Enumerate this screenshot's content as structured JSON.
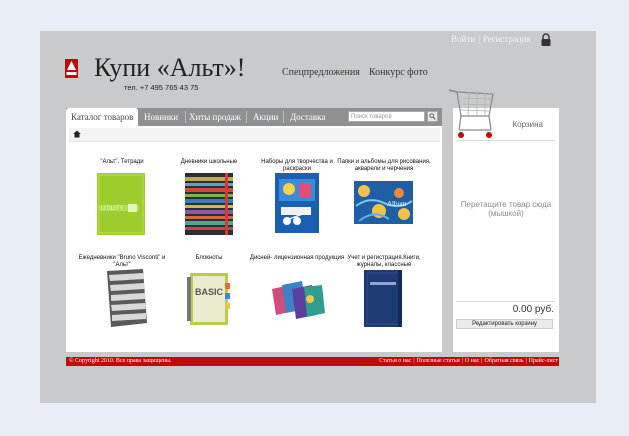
{
  "header": {
    "brand": "Купи «Альт»!",
    "phone": "тел.   +7 495 765 43 75",
    "links": [
      "Спецпредложения",
      "Конкурс фото"
    ],
    "login": "Войти",
    "separator": "|",
    "register": "Регистрация"
  },
  "nav": {
    "tabs": [
      "Каталог товаров",
      "Новинки",
      "Хиты продаж",
      "Акции",
      "Доставка"
    ],
    "search_placeholder": "Поиск товаров"
  },
  "catalog": {
    "items": [
      {
        "label": "\"Альт\". Тетради",
        "thumb": "green-notebook"
      },
      {
        "label": "Дневники школьные",
        "thumb": "striped-diary"
      },
      {
        "label": "Наборы для творчества и раскраски",
        "thumb": "blue-craft-set"
      },
      {
        "label": "Папки и альбомы для рисования, акварели и черчения",
        "thumb": "floral-album",
        "thumb_text": "Album"
      },
      {
        "label": "Ежедневники \"Bruno Visconti\" и \"Альт\"",
        "thumb": "striped-planner"
      },
      {
        "label": "Блокноты",
        "thumb": "abc-notebook",
        "thumb_text": "BASIC"
      },
      {
        "label": "Дисней- лицензионная продукция",
        "thumb": "disney-notebooks"
      },
      {
        "label": "Учет и регистрация.Книги, журналы, классные",
        "thumb": "blue-register-book"
      }
    ]
  },
  "cart": {
    "title": "Корзина",
    "drop_hint": "Перетащите товар сюда (мышкой)",
    "total": "0.00 руб.",
    "edit_button": "Редактировать корзину"
  },
  "footer": {
    "copyright": "© Copyright 2010. Все права защищены.",
    "links": [
      "Статьи о нас",
      "Полезные статьи",
      "О нас",
      "Обратная связь",
      "Прайс-лист"
    ]
  },
  "colors": {
    "frame": "#c9cacb",
    "nav_bar": "#8f9091",
    "footer": "#c30a0a"
  }
}
